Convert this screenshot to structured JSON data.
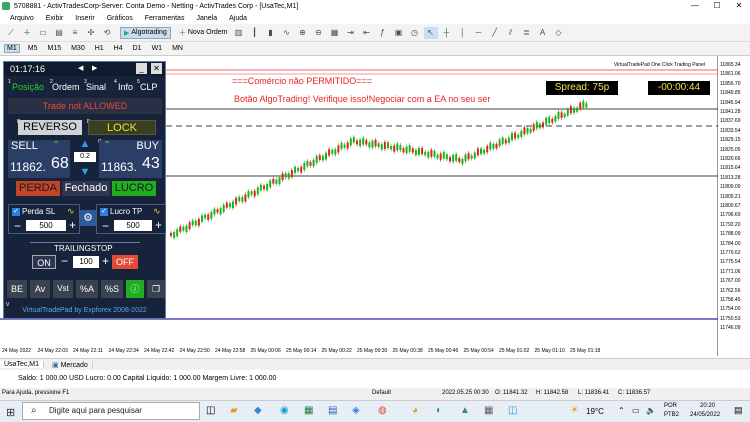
{
  "window": {
    "title": "5708881 - ActivTradesCorp-Server: Conta Demo - Netting - ActivTrades Corp - [UsaTec,M1]"
  },
  "menu": [
    "Arquivo",
    "Exibir",
    "Inserir",
    "Gráficos",
    "Ferramentas",
    "Janela",
    "Ajuda"
  ],
  "toolbar": {
    "algotrading": "Algotrading",
    "new_order": "Nova Ordem"
  },
  "timeframes": [
    "M1",
    "M5",
    "M15",
    "M30",
    "H1",
    "H4",
    "D1",
    "W1",
    "MN"
  ],
  "chart": {
    "panel_label": "VirtualTradePad One Click Trading Panel",
    "warning_line1": "===Comércio não PERMITIDO===",
    "warning_line2": "Botão AlgoTrading! Verifique isso!Negociar com a EA no seu ser",
    "spread": "Spread: 75p",
    "countdown": "-00:00:44",
    "price_labels": [
      "11865.34",
      "11861.06",
      "11856.70",
      "11849.85",
      "11845.94",
      "11841.28",
      "11837.69",
      "11833.54",
      "11829.15",
      "11825.05",
      "11820.66",
      "11815.64",
      "11813.28",
      "11809.09",
      "11805.21",
      "11800.67",
      "11796.69",
      "11792.20",
      "11788.09",
      "11784.00",
      "11779.62",
      "11775.54",
      "11771.06",
      "11767.00",
      "11762.56",
      "11758.45",
      "11754.00",
      "11750.53",
      "11746.09"
    ],
    "time_labels": [
      "24 May 2022",
      "24 May 22:03",
      "24 May 22:11",
      "24 May 22:34",
      "24 May 22:42",
      "24 May 22:50",
      "24 May 22:58",
      "25 May 00:06",
      "25 May 00:14",
      "25 May 00:22",
      "25 May 00:30",
      "25 May 00:38",
      "25 May 00:46",
      "25 May 00:54",
      "25 May 01:02",
      "25 May 01:10",
      "25 May 01:18"
    ]
  },
  "panel": {
    "clock": "01:17:16",
    "tabs": [
      "Posição",
      "Ordem",
      "Sinal",
      "Info",
      "CLP"
    ],
    "tab_nums": [
      "1",
      "2",
      "3",
      "4",
      "5"
    ],
    "trade_status": "Trade not ALLOWED",
    "reverse": "REVERSO",
    "lock": "LOCK",
    "sell": "SELL",
    "buy": "BUY",
    "lot": "0.2",
    "sell_price_main": "11862.",
    "sell_price_big": "68",
    "buy_price_main": "11863.",
    "buy_price_big": "43",
    "loss": "PERDA",
    "closed": "Fechado",
    "profit": "LUCRO",
    "sl_label": "Perda SL",
    "sl_value": "500",
    "tp_label": "Lucro TP",
    "tp_value": "500",
    "trailing": "TRAILINGSTOP",
    "on": "ON",
    "trailing_value": "100",
    "off": "OFF",
    "bottom_buttons": [
      "BE",
      "Av",
      "Vst",
      "%A",
      "%S"
    ],
    "footer": "VirtualTradePad by Expforex 2008-2022",
    "letter_r": "R",
    "letter_e": "E",
    "letter_c": "C",
    "letter_v": "V"
  },
  "tabs": [
    "UsaTec,M1",
    "Mercado"
  ],
  "balance": "Saldo: 1 000.00 USD  Lucro: 0.00  Capital Líquido: 1 000.00  Margem Livre: 1 000.00",
  "status": {
    "help": "Para Ajuda, pressione F1",
    "default": "Default",
    "datetime": "2022.05.25 00:30",
    "open": "O: 11841.32",
    "high": "H: 11842.58",
    "low": "L: 11836.41",
    "close": "C: 11836.57"
  },
  "taskbar": {
    "search": "Digite aqui para pesquisar",
    "weather": "19°C",
    "lang1": "POR",
    "lang2": "PTB2",
    "time": "20:20",
    "date": "24/05/2022"
  },
  "colors": {
    "panel_bg": "#16233a",
    "warning": "#e22",
    "spread": "#f5e14a",
    "green": "#1db31d",
    "red": "#e04a2a"
  }
}
